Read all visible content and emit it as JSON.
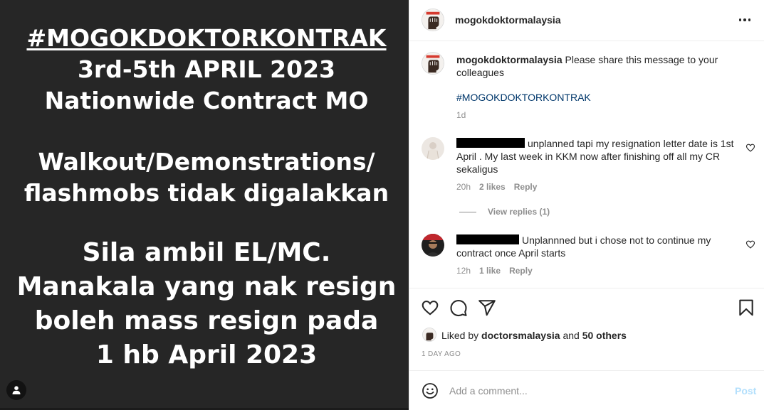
{
  "media": {
    "hashtag": "#MOGOKDOKTORKONTRAK",
    "dates": "3rd-5th APRIL 2023",
    "subtitle": "Nationwide Contract MO",
    "note_line1": "Walkout/Demonstrations/",
    "note_line2": "flashmobs tidak digalakkan",
    "instr_line1": "Sila ambil EL/MC.",
    "instr_line2": "Manakala yang nak resign",
    "instr_line3": "boleh mass resign pada",
    "instr_line4": "1 hb April 2023",
    "tag_icon": "person-icon"
  },
  "header": {
    "username": "mogokdoktormalaysia",
    "more_icon": "more-options-icon"
  },
  "caption": {
    "username": "mogokdoktormalaysia",
    "text": "Please share this message to your colleagues",
    "hashtag": "#MOGOKDOKTORKONTRAK",
    "time": "1d"
  },
  "comments": [
    {
      "text": "unplanned tapi my resignation letter date is 1st April . My last week in KKM now after finishing off all my CR sekaligus",
      "time": "20h",
      "likes": "2 likes",
      "reply": "Reply",
      "view_replies": "View replies (1)"
    },
    {
      "text": "Unplannned but i chose not to continue my contract once April starts",
      "time": "12h",
      "likes": "1 like",
      "reply": "Reply"
    }
  ],
  "actions": {
    "like_icon": "heart-icon",
    "comment_icon": "comment-icon",
    "share_icon": "send-icon",
    "save_icon": "bookmark-icon"
  },
  "likes": {
    "prefix": "Liked by",
    "user": "doctorsmalaysia",
    "and": "and",
    "others": "50 others"
  },
  "post_date": "1 DAY AGO",
  "add_comment": {
    "placeholder": "Add a comment...",
    "post_label": "Post",
    "emoji_icon": "smiley-icon"
  },
  "colors": {
    "media_bg": "#262626",
    "link": "#00376b",
    "muted": "#8e8e8e",
    "post_disabled": "#b2dffc"
  }
}
